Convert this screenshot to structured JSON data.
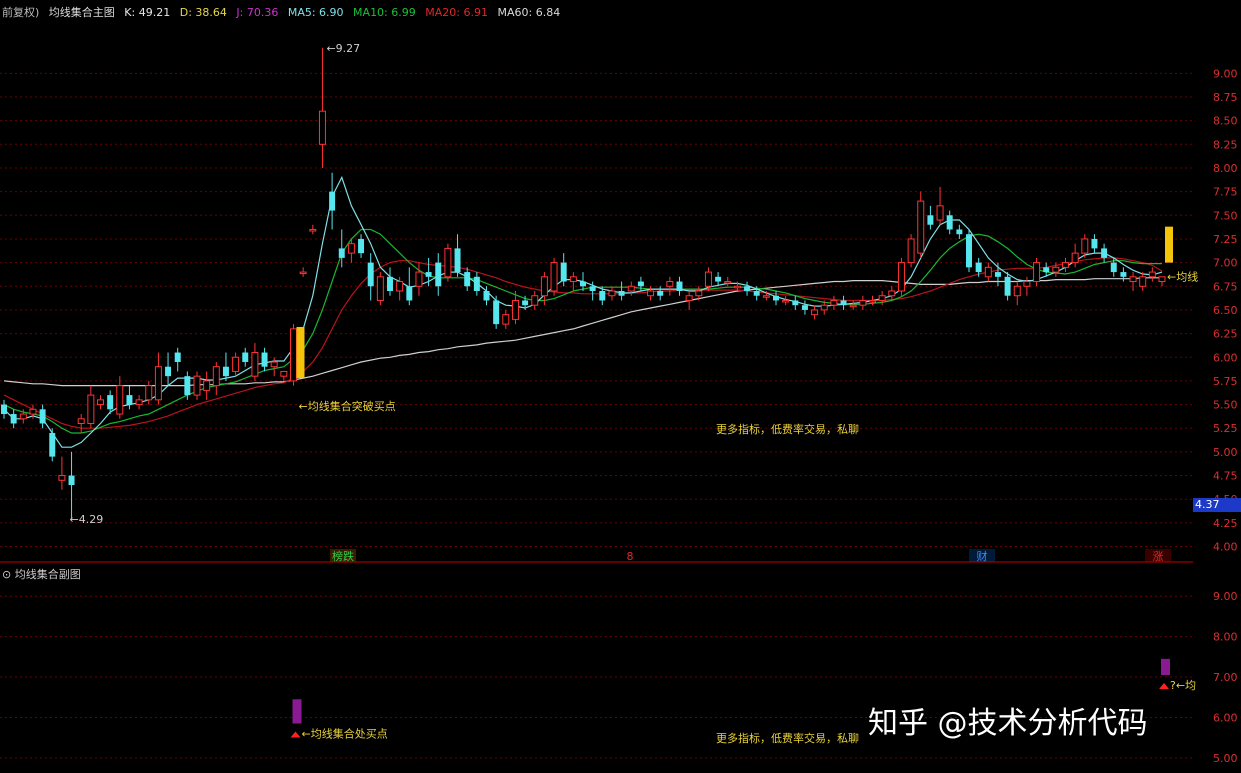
{
  "header": {
    "prefix": "前复权)",
    "chart_title": "均线集合主图",
    "k_label": "K: 49.21",
    "d_label": "D: 38.64",
    "j_label": "J: 70.36",
    "ma5_label": "MA5: 6.90",
    "ma10_label": "MA10: 6.99",
    "ma20_label": "MA20: 6.91",
    "ma60_label": "MA60: 6.84"
  },
  "sub_header": {
    "title": "均线集合副图"
  },
  "price_tag": "4.37",
  "watermark": "知乎 @技术分析代码",
  "colors": {
    "up": "#ff3333",
    "down": "#55e6ee",
    "ma5": "#7fe0e6",
    "ma10": "#16b832",
    "ma20": "#b8141e",
    "ma60": "#cfcfcf",
    "grid": "#6a0000",
    "axis_text": "#d83030",
    "annotation": "#e8d23a",
    "signal_bar": "#f3c40a",
    "sub_bar": "#8a1a92"
  },
  "chart_data": [
    {
      "type": "candlestick",
      "title": "均线集合主图",
      "ylim": [
        3.9,
        9.5
      ],
      "yticks": [
        "9.00",
        "8.75",
        "8.50",
        "8.25",
        "8.00",
        "7.75",
        "7.50",
        "7.25",
        "7.00",
        "6.75",
        "6.50",
        "6.25",
        "6.00",
        "5.75",
        "5.50",
        "5.25",
        "5.00",
        "4.75",
        "4.50",
        "4.25",
        "4.00"
      ],
      "candles": [
        [
          5.5,
          5.55,
          5.35,
          5.4
        ],
        [
          5.4,
          5.45,
          5.25,
          5.3
        ],
        [
          5.35,
          5.45,
          5.3,
          5.4
        ],
        [
          5.4,
          5.5,
          5.35,
          5.45
        ],
        [
          5.45,
          5.5,
          5.25,
          5.3
        ],
        [
          5.2,
          5.25,
          4.9,
          4.95
        ],
        [
          4.7,
          4.95,
          4.6,
          4.75
        ],
        [
          4.75,
          5.0,
          4.3,
          4.65
        ],
        [
          5.3,
          5.4,
          5.2,
          5.35
        ],
        [
          5.3,
          5.7,
          5.25,
          5.6
        ],
        [
          5.5,
          5.6,
          5.45,
          5.55
        ],
        [
          5.6,
          5.65,
          5.4,
          5.45
        ],
        [
          5.4,
          5.8,
          5.35,
          5.7
        ],
        [
          5.6,
          5.7,
          5.45,
          5.5
        ],
        [
          5.5,
          5.6,
          5.45,
          5.55
        ],
        [
          5.55,
          5.75,
          5.5,
          5.7
        ],
        [
          5.55,
          6.05,
          5.5,
          5.9
        ],
        [
          5.9,
          6.05,
          5.7,
          5.8
        ],
        [
          6.05,
          6.1,
          5.85,
          5.95
        ],
        [
          5.8,
          5.85,
          5.55,
          5.6
        ],
        [
          5.6,
          5.85,
          5.55,
          5.8
        ],
        [
          5.65,
          5.85,
          5.55,
          5.75
        ],
        [
          5.7,
          5.95,
          5.6,
          5.9
        ],
        [
          5.9,
          6.05,
          5.75,
          5.8
        ],
        [
          5.85,
          6.05,
          5.8,
          6.0
        ],
        [
          6.05,
          6.1,
          5.9,
          5.95
        ],
        [
          5.8,
          6.15,
          5.75,
          6.05
        ],
        [
          6.05,
          6.1,
          5.85,
          5.9
        ],
        [
          5.9,
          6.0,
          5.8,
          5.95
        ],
        [
          5.8,
          5.85,
          5.75,
          5.85
        ],
        [
          5.75,
          6.35,
          5.7,
          6.3
        ],
        [
          6.9,
          6.95,
          6.85,
          6.9
        ],
        [
          7.35,
          7.4,
          7.3,
          7.35
        ],
        [
          8.25,
          9.27,
          8.0,
          8.6
        ],
        [
          7.75,
          7.95,
          7.35,
          7.55
        ],
        [
          7.15,
          7.35,
          6.95,
          7.05
        ],
        [
          7.1,
          7.25,
          7.0,
          7.2
        ],
        [
          7.25,
          7.3,
          7.05,
          7.1
        ],
        [
          7.0,
          7.1,
          6.6,
          6.75
        ],
        [
          6.6,
          6.9,
          6.55,
          6.85
        ],
        [
          6.85,
          6.95,
          6.65,
          6.7
        ],
        [
          6.7,
          6.85,
          6.6,
          6.8
        ],
        [
          6.75,
          6.95,
          6.55,
          6.6
        ],
        [
          6.75,
          7.0,
          6.65,
          6.9
        ],
        [
          6.9,
          7.05,
          6.75,
          6.85
        ],
        [
          7.0,
          7.1,
          6.65,
          6.75
        ],
        [
          6.85,
          7.2,
          6.8,
          7.15
        ],
        [
          7.15,
          7.3,
          6.85,
          6.9
        ],
        [
          6.9,
          6.95,
          6.7,
          6.75
        ],
        [
          6.85,
          6.9,
          6.65,
          6.7
        ],
        [
          6.7,
          6.75,
          6.55,
          6.6
        ],
        [
          6.6,
          6.65,
          6.3,
          6.35
        ],
        [
          6.35,
          6.5,
          6.3,
          6.45
        ],
        [
          6.4,
          6.7,
          6.35,
          6.6
        ],
        [
          6.6,
          6.65,
          6.5,
          6.55
        ],
        [
          6.55,
          6.7,
          6.5,
          6.65
        ],
        [
          6.65,
          6.9,
          6.55,
          6.85
        ],
        [
          6.7,
          7.05,
          6.65,
          7.0
        ],
        [
          7.0,
          7.1,
          6.75,
          6.8
        ],
        [
          6.8,
          6.9,
          6.7,
          6.85
        ],
        [
          6.8,
          6.9,
          6.7,
          6.75
        ],
        [
          6.75,
          6.8,
          6.6,
          6.7
        ],
        [
          6.7,
          6.75,
          6.55,
          6.6
        ],
        [
          6.65,
          6.75,
          6.6,
          6.7
        ],
        [
          6.7,
          6.8,
          6.6,
          6.65
        ],
        [
          6.7,
          6.8,
          6.65,
          6.75
        ],
        [
          6.8,
          6.85,
          6.7,
          6.75
        ],
        [
          6.65,
          6.75,
          6.6,
          6.7
        ],
        [
          6.7,
          6.75,
          6.6,
          6.65
        ],
        [
          6.75,
          6.85,
          6.65,
          6.8
        ],
        [
          6.8,
          6.85,
          6.65,
          6.7
        ],
        [
          6.6,
          6.7,
          6.5,
          6.65
        ],
        [
          6.65,
          6.75,
          6.6,
          6.7
        ],
        [
          6.75,
          6.95,
          6.7,
          6.9
        ],
        [
          6.85,
          6.9,
          6.75,
          6.8
        ],
        [
          6.8,
          6.85,
          6.75,
          6.8
        ],
        [
          6.75,
          6.8,
          6.7,
          6.75
        ],
        [
          6.75,
          6.8,
          6.65,
          6.7
        ],
        [
          6.7,
          6.75,
          6.6,
          6.65
        ],
        [
          6.65,
          6.7,
          6.6,
          6.65
        ],
        [
          6.65,
          6.7,
          6.55,
          6.6
        ],
        [
          6.6,
          6.65,
          6.55,
          6.6
        ],
        [
          6.6,
          6.65,
          6.5,
          6.55
        ],
        [
          6.55,
          6.6,
          6.45,
          6.5
        ],
        [
          6.45,
          6.55,
          6.4,
          6.5
        ],
        [
          6.5,
          6.6,
          6.45,
          6.55
        ],
        [
          6.55,
          6.65,
          6.5,
          6.6
        ],
        [
          6.6,
          6.65,
          6.5,
          6.55
        ],
        [
          6.55,
          6.6,
          6.5,
          6.55
        ],
        [
          6.55,
          6.65,
          6.5,
          6.6
        ],
        [
          6.6,
          6.65,
          6.55,
          6.6
        ],
        [
          6.6,
          6.7,
          6.55,
          6.65
        ],
        [
          6.65,
          6.75,
          6.6,
          6.7
        ],
        [
          6.7,
          7.05,
          6.65,
          7.0
        ],
        [
          7.0,
          7.3,
          6.95,
          7.25
        ],
        [
          7.1,
          7.75,
          7.05,
          7.65
        ],
        [
          7.5,
          7.6,
          7.35,
          7.4
        ],
        [
          7.45,
          7.8,
          7.4,
          7.6
        ],
        [
          7.5,
          7.55,
          7.3,
          7.35
        ],
        [
          7.35,
          7.4,
          7.25,
          7.3
        ],
        [
          7.3,
          7.35,
          6.9,
          6.95
        ],
        [
          7.0,
          7.05,
          6.85,
          6.9
        ],
        [
          6.85,
          7.0,
          6.8,
          6.95
        ],
        [
          6.9,
          7.0,
          6.75,
          6.85
        ],
        [
          6.85,
          6.9,
          6.6,
          6.65
        ],
        [
          6.65,
          6.8,
          6.55,
          6.75
        ],
        [
          6.75,
          6.85,
          6.65,
          6.8
        ],
        [
          6.8,
          7.05,
          6.75,
          7.0
        ],
        [
          6.95,
          7.0,
          6.85,
          6.9
        ],
        [
          6.9,
          7.0,
          6.85,
          6.95
        ],
        [
          6.95,
          7.05,
          6.9,
          7.0
        ],
        [
          7.0,
          7.2,
          6.95,
          7.1
        ],
        [
          7.1,
          7.3,
          7.05,
          7.25
        ],
        [
          7.25,
          7.3,
          7.1,
          7.15
        ],
        [
          7.15,
          7.2,
          7.0,
          7.05
        ],
        [
          7.0,
          7.05,
          6.85,
          6.9
        ],
        [
          6.9,
          6.95,
          6.8,
          6.85
        ],
        [
          6.8,
          6.9,
          6.7,
          6.85
        ],
        [
          6.75,
          6.9,
          6.7,
          6.85
        ],
        [
          6.85,
          6.95,
          6.8,
          6.9
        ],
        [
          6.8,
          6.85,
          6.75,
          6.85
        ]
      ],
      "ma5": [
        5.45,
        5.35,
        5.35,
        5.38,
        5.35,
        5.2,
        5.05,
        5.05,
        5.1,
        5.2,
        5.3,
        5.42,
        5.48,
        5.5,
        5.52,
        5.55,
        5.6,
        5.7,
        5.78,
        5.78,
        5.78,
        5.76,
        5.76,
        5.78,
        5.8,
        5.86,
        5.92,
        5.94,
        5.96,
        5.96,
        6.1,
        6.3,
        6.65,
        7.2,
        7.7,
        7.9,
        7.6,
        7.4,
        7.2,
        6.95,
        6.85,
        6.8,
        6.74,
        6.76,
        6.8,
        6.86,
        6.9,
        6.9,
        6.85,
        6.78,
        6.7,
        6.6,
        6.55,
        6.54,
        6.52,
        6.56,
        6.66,
        6.75,
        6.82,
        6.82,
        6.8,
        6.76,
        6.72,
        6.7,
        6.68,
        6.68,
        6.7,
        6.72,
        6.72,
        6.72,
        6.72,
        6.7,
        6.7,
        6.74,
        6.76,
        6.78,
        6.78,
        6.76,
        6.72,
        6.68,
        6.64,
        6.61,
        6.59,
        6.56,
        6.54,
        6.54,
        6.55,
        6.56,
        6.57,
        6.58,
        6.6,
        6.62,
        6.65,
        6.72,
        6.85,
        7.05,
        7.25,
        7.4,
        7.45,
        7.45,
        7.35,
        7.2,
        7.05,
        6.95,
        6.88,
        6.82,
        6.8,
        6.82,
        6.86,
        6.9,
        6.95,
        7.02,
        7.08,
        7.1,
        7.1,
        7.05,
        6.98,
        6.92,
        6.88,
        6.87,
        6.9
      ],
      "ma10": [
        5.5,
        5.45,
        5.42,
        5.4,
        5.38,
        5.32,
        5.25,
        5.2,
        5.2,
        5.22,
        5.26,
        5.3,
        5.32,
        5.35,
        5.38,
        5.4,
        5.45,
        5.5,
        5.55,
        5.6,
        5.64,
        5.68,
        5.7,
        5.72,
        5.74,
        5.78,
        5.82,
        5.86,
        5.88,
        5.9,
        5.98,
        6.08,
        6.25,
        6.5,
        6.8,
        7.1,
        7.25,
        7.35,
        7.35,
        7.3,
        7.2,
        7.1,
        7.0,
        6.92,
        6.86,
        6.84,
        6.84,
        6.84,
        6.84,
        6.82,
        6.78,
        6.74,
        6.7,
        6.66,
        6.62,
        6.6,
        6.6,
        6.62,
        6.66,
        6.7,
        6.72,
        6.74,
        6.74,
        6.74,
        6.74,
        6.74,
        6.73,
        6.72,
        6.72,
        6.72,
        6.72,
        6.72,
        6.72,
        6.72,
        6.73,
        6.74,
        6.74,
        6.74,
        6.73,
        6.72,
        6.7,
        6.68,
        6.65,
        6.62,
        6.6,
        6.58,
        6.57,
        6.56,
        6.56,
        6.56,
        6.57,
        6.58,
        6.6,
        6.64,
        6.7,
        6.8,
        6.92,
        7.05,
        7.15,
        7.22,
        7.28,
        7.3,
        7.28,
        7.22,
        7.15,
        7.06,
        6.98,
        6.93,
        6.9,
        6.89,
        6.88,
        6.9,
        6.94,
        6.98,
        7.0,
        7.02,
        7.02,
        7.0,
        6.99,
        6.99,
        6.99
      ],
      "ma20": [
        5.6,
        5.55,
        5.5,
        5.45,
        5.4,
        5.35,
        5.3,
        5.27,
        5.25,
        5.25,
        5.25,
        5.26,
        5.27,
        5.28,
        5.3,
        5.32,
        5.35,
        5.38,
        5.42,
        5.46,
        5.5,
        5.53,
        5.56,
        5.59,
        5.62,
        5.65,
        5.68,
        5.7,
        5.72,
        5.73,
        5.78,
        5.85,
        5.95,
        6.1,
        6.3,
        6.5,
        6.65,
        6.78,
        6.88,
        6.95,
        7.0,
        7.02,
        7.02,
        7.0,
        6.98,
        6.97,
        6.96,
        6.95,
        6.93,
        6.9,
        6.87,
        6.84,
        6.8,
        6.77,
        6.74,
        6.72,
        6.7,
        6.69,
        6.68,
        6.68,
        6.67,
        6.67,
        6.67,
        6.67,
        6.67,
        6.68,
        6.68,
        6.69,
        6.7,
        6.7,
        6.71,
        6.71,
        6.71,
        6.71,
        6.71,
        6.71,
        6.71,
        6.7,
        6.69,
        6.68,
        6.67,
        6.66,
        6.65,
        6.64,
        6.63,
        6.62,
        6.61,
        6.6,
        6.6,
        6.6,
        6.6,
        6.6,
        6.61,
        6.62,
        6.64,
        6.67,
        6.7,
        6.74,
        6.78,
        6.82,
        6.85,
        6.88,
        6.9,
        6.92,
        6.93,
        6.94,
        6.94,
        6.94,
        6.95,
        6.97,
        6.99,
        7.01,
        7.03,
        7.04,
        7.05,
        7.05,
        7.04,
        7.02,
        7.0,
        6.97,
        6.91
      ],
      "ma60": [
        5.75,
        5.74,
        5.73,
        5.72,
        5.72,
        5.71,
        5.7,
        5.7,
        5.7,
        5.7,
        5.7,
        5.7,
        5.7,
        5.7,
        5.7,
        5.7,
        5.7,
        5.7,
        5.7,
        5.7,
        5.71,
        5.71,
        5.71,
        5.72,
        5.72,
        5.72,
        5.73,
        5.73,
        5.74,
        5.74,
        5.76,
        5.78,
        5.8,
        5.83,
        5.86,
        5.89,
        5.92,
        5.95,
        5.97,
        5.99,
        6.0,
        6.02,
        6.03,
        6.05,
        6.06,
        6.08,
        6.09,
        6.11,
        6.12,
        6.13,
        6.15,
        6.16,
        6.17,
        6.18,
        6.2,
        6.22,
        6.24,
        6.26,
        6.28,
        6.3,
        6.33,
        6.36,
        6.39,
        6.42,
        6.45,
        6.48,
        6.5,
        6.52,
        6.54,
        6.56,
        6.58,
        6.6,
        6.62,
        6.64,
        6.66,
        6.68,
        6.7,
        6.71,
        6.72,
        6.73,
        6.74,
        6.75,
        6.76,
        6.77,
        6.78,
        6.79,
        6.8,
        6.8,
        6.81,
        6.81,
        6.81,
        6.81,
        6.8,
        6.79,
        6.78,
        6.77,
        6.77,
        6.77,
        6.77,
        6.78,
        6.79,
        6.79,
        6.8,
        6.8,
        6.8,
        6.8,
        6.81,
        6.81,
        6.81,
        6.82,
        6.82,
        6.82,
        6.82,
        6.83,
        6.83,
        6.83,
        6.83,
        6.83,
        6.84,
        6.84,
        6.84
      ],
      "signals": [
        {
          "index": 30,
          "from": 5.78,
          "to": 6.32,
          "label": "←均线集合突破买点"
        },
        {
          "index": 120,
          "from": 7.0,
          "to": 7.38,
          "label": "←均线"
        }
      ],
      "annotations": {
        "high": "←9.27",
        "low": "←4.29",
        "promo": "更多指标，低费率交易，私聊"
      },
      "date_markers": [
        "榜跌",
        "8",
        "财",
        "涨"
      ]
    },
    {
      "type": "bar",
      "title": "均线集合副图",
      "ylim": [
        4.7,
        9.6
      ],
      "yticks": [
        "9.00",
        "8.00",
        "7.00",
        "6.00",
        "5.00"
      ],
      "bars": [
        {
          "index": 30,
          "from": 5.85,
          "to": 6.45,
          "label": "←均线集合处买点"
        },
        {
          "index": 120,
          "from": 7.05,
          "to": 7.45,
          "label": "?←均"
        }
      ],
      "promo": "更多指标，低费率交易，私聊"
    }
  ]
}
